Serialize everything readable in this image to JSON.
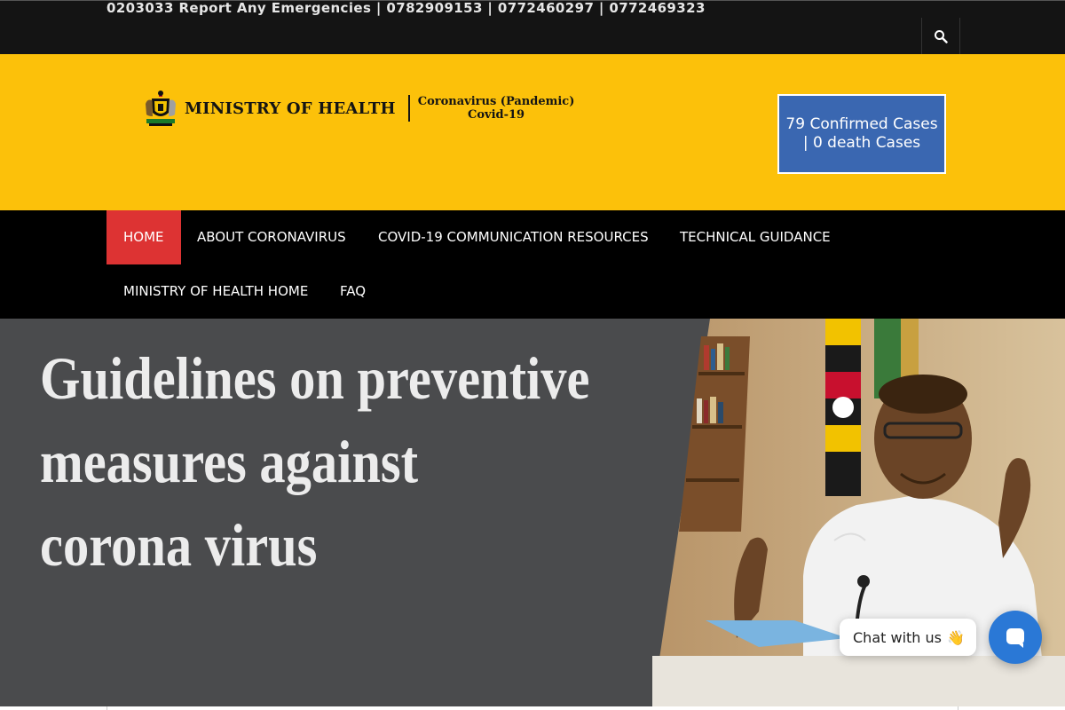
{
  "topbar": {
    "ticker": "0203033 Report Any Emergencies | 0782909153 | 0772460297 | 0772469323",
    "search_icon": "search-icon"
  },
  "header": {
    "ministry": "MINISTRY OF HEALTH",
    "subtitle_line1": "Coronavirus (Pandemic)",
    "subtitle_line2": "Covid-19",
    "cases": "79 Confirmed Cases | 0 death Cases",
    "logo_icon": "uganda-coat-of-arms-icon"
  },
  "nav": {
    "items": [
      {
        "label": "HOME",
        "active": true
      },
      {
        "label": "ABOUT CORONAVIRUS"
      },
      {
        "label": "COVID-19 COMMUNICATION RESOURCES"
      },
      {
        "label": "TECHNICAL GUIDANCE"
      },
      {
        "label": "MINISTRY OF HEALTH HOME"
      },
      {
        "label": "FAQ"
      }
    ]
  },
  "hero": {
    "line1": "Guidelines on preventive",
    "line2": "measures against",
    "line3": "corona virus"
  },
  "chat": {
    "label": "Chat with us",
    "emoji": "👋",
    "launcher_icon": "chat-icon"
  },
  "colors": {
    "topbar": "#141414",
    "header": "#fcc10a",
    "cases_box": "#3a67b1",
    "nav": "#000000",
    "nav_active": "#dd3333",
    "hero_bg": "#4a4b4d",
    "chat_launcher": "#2a78d6"
  }
}
